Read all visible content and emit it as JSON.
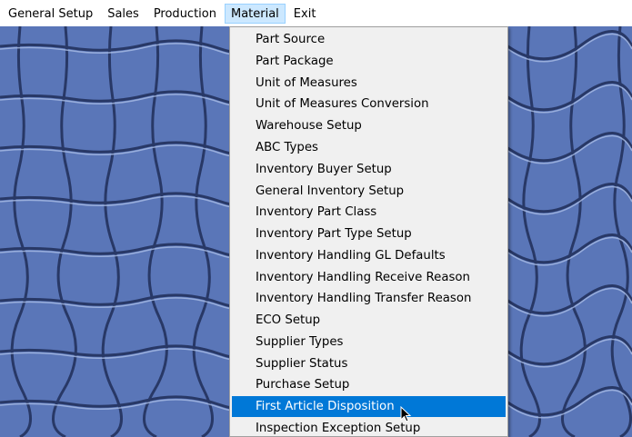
{
  "menubar": {
    "items": [
      {
        "label": "General Setup"
      },
      {
        "label": "Sales"
      },
      {
        "label": "Production"
      },
      {
        "label": "Material"
      },
      {
        "label": "Exit"
      }
    ],
    "active_item": "Material"
  },
  "dropdown": {
    "items": [
      {
        "label": "Part Source"
      },
      {
        "label": "Part Package"
      },
      {
        "label": "Unit of Measures"
      },
      {
        "label": "Unit of Measures Conversion"
      },
      {
        "label": "Warehouse Setup"
      },
      {
        "label": "ABC Types"
      },
      {
        "label": "Inventory Buyer Setup"
      },
      {
        "label": "General Inventory Setup"
      },
      {
        "label": "Inventory Part Class"
      },
      {
        "label": "Inventory Part Type Setup"
      },
      {
        "label": "Inventory Handling GL Defaults"
      },
      {
        "label": "Inventory Handling Receive Reason"
      },
      {
        "label": "Inventory Handling Transfer Reason"
      },
      {
        "label": "ECO Setup"
      },
      {
        "label": "Supplier Types"
      },
      {
        "label": "Supplier Status"
      },
      {
        "label": "Purchase Setup"
      },
      {
        "label": "First Article Disposition"
      },
      {
        "label": "Inspection Exception Setup"
      }
    ],
    "highlighted_item": "First Article Disposition"
  },
  "colors": {
    "menu_active_bg": "#cce8ff",
    "highlight_bg": "#0078d7",
    "desktop_bg": "#5a76b8"
  },
  "icons": {
    "cursor": "arrow-cursor-icon",
    "background": "wallpaper-pattern"
  }
}
